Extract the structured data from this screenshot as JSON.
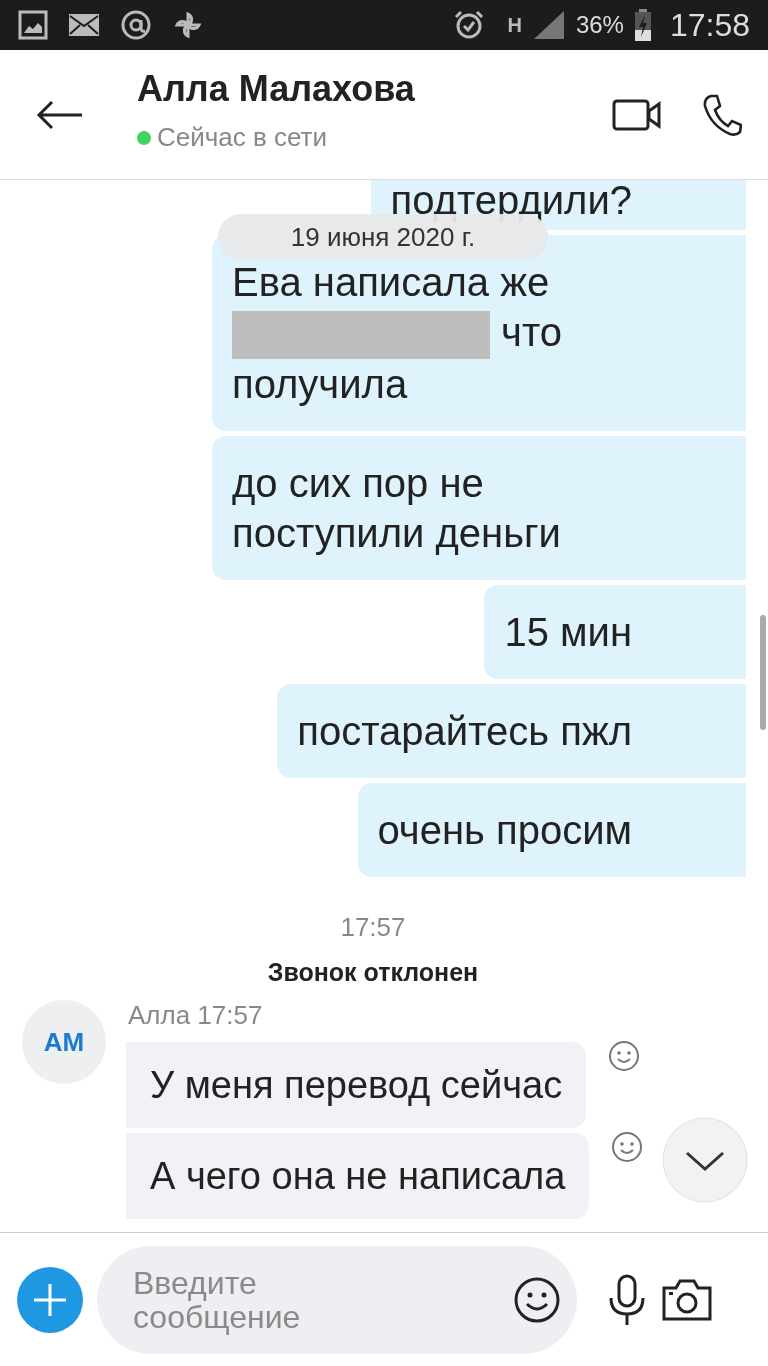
{
  "status_bar": {
    "network": "H",
    "battery": "36%",
    "time": "17:58"
  },
  "header": {
    "title": "Алла Малахова",
    "presence": "Сейчас в сети",
    "online": true
  },
  "date_pill": "19 июня 2020 г.",
  "messages": [
    {
      "kind": "outgoing",
      "text": "подтердили?"
    },
    {
      "kind": "outgoing_redacted",
      "text_before": "Ева написала же",
      "text_after": "что получила"
    },
    {
      "kind": "outgoing",
      "text": "до сих пор не поступили деньги"
    },
    {
      "kind": "outgoing",
      "text": "15 мин"
    },
    {
      "kind": "outgoing",
      "text": "постарайтесь пжл"
    },
    {
      "kind": "outgoing",
      "text": "очень просим"
    },
    {
      "kind": "time",
      "text": "17:57"
    },
    {
      "kind": "event",
      "text": "Звонок отклонен"
    },
    {
      "kind": "incoming_group",
      "initials": "AM",
      "meta": "Алла 17:57",
      "bubbles": [
        "У меня перевод сейчас",
        "А чего она не написала"
      ]
    }
  ],
  "composer": {
    "placeholder": "Введите сообщение"
  }
}
